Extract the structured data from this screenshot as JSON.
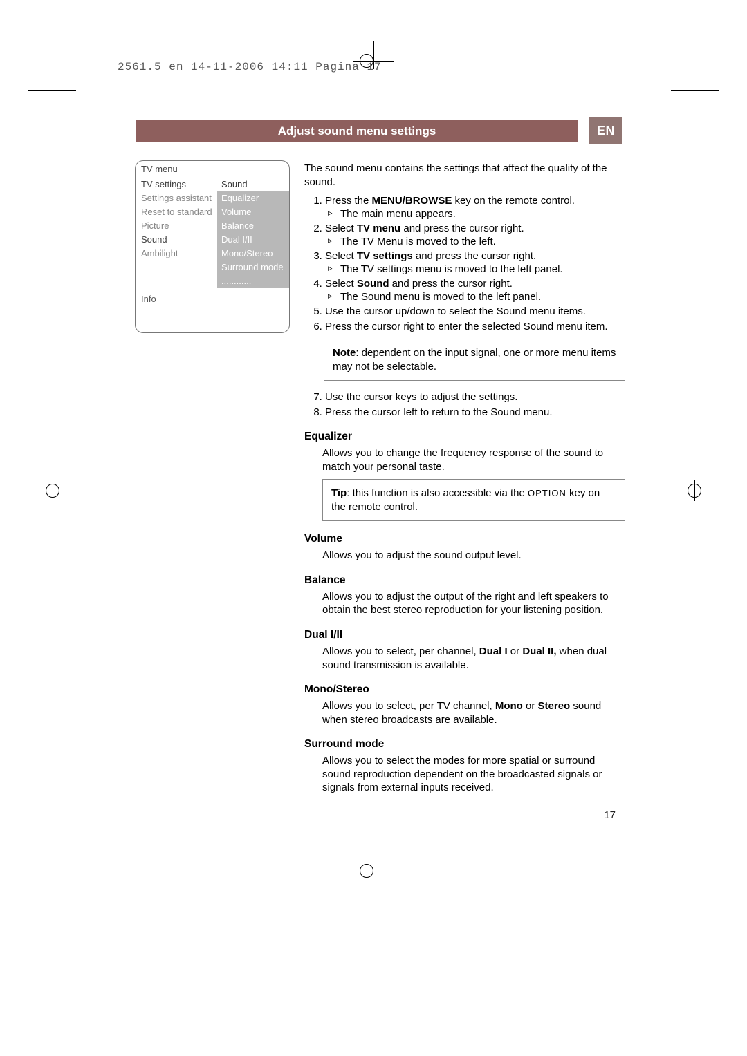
{
  "folio": "2561.5 en  14-11-2006  14:11  Pagina 17",
  "titlebar": "Adjust sound menu settings",
  "langtab": "EN",
  "menu": {
    "title": "TV menu",
    "left": [
      "TV settings",
      "Settings assistant",
      "Reset to standard",
      "Picture",
      "Sound",
      "Ambilight"
    ],
    "right_header": "Sound",
    "right": [
      "Equalizer",
      "Volume",
      "Balance",
      "Dual I/II",
      "Mono/Stereo",
      "Surround mode",
      "............"
    ],
    "info": "Info"
  },
  "intro": "The sound menu contains the settings that affect the quality of the sound.",
  "steps": [
    {
      "n": "1",
      "t": "Press the ",
      "b": "MENU/BROWSE",
      "t2": " key on the remote control.",
      "sub": "The main menu appears."
    },
    {
      "n": "2",
      "t": "Select ",
      "b": "TV menu",
      "t2": " and press the cursor right.",
      "sub": "The TV Menu is moved to the left."
    },
    {
      "n": "3",
      "t": "Select ",
      "b": "TV settings",
      "t2": " and press the cursor right.",
      "sub": "The TV settings menu is moved to the left panel."
    },
    {
      "n": "4",
      "t": "Select ",
      "b": "Sound",
      "t2": " and press the cursor right.",
      "sub": "The Sound menu is moved to the left panel."
    },
    {
      "n": "5",
      "t": "Use the cursor up/down to select the Sound menu items."
    },
    {
      "n": "6",
      "t": "Press the cursor right to enter the selected Sound menu item."
    }
  ],
  "note_b": "Note",
  "note": ": dependent on the input signal, one or more menu items may not be selectable.",
  "steps2": [
    {
      "n": "7",
      "t": "Use the cursor keys to adjust the settings."
    },
    {
      "n": "8",
      "t": "Press the cursor left to return to the Sound menu."
    }
  ],
  "sections": [
    {
      "h": "Equalizer",
      "p": "Allows you to change the frequency response of the sound to match your personal taste.",
      "tip_b": "Tip",
      "tip": ": this function is also accessible via the ",
      "tip_sc": "OPTION",
      "tip2": " key on the remote control."
    },
    {
      "h": "Volume",
      "p": "Allows you to adjust the sound output level."
    },
    {
      "h": "Balance",
      "p": "Allows you to adjust the output of the right and left speakers to obtain the best stereo reproduction for your listening position."
    },
    {
      "h": "Dual I/II",
      "p": "Allows you to select, per channel, ",
      "b1": "Dual I",
      "mid": " or ",
      "b2": "Dual II,",
      "p2": " when dual sound transmission is available."
    },
    {
      "h": "Mono/Stereo",
      "p": "Allows you to select, per TV channel, ",
      "b1": "Mono",
      "mid": " or ",
      "b2": "Stereo",
      "p2": " sound when stereo broadcasts are available."
    },
    {
      "h": "Surround mode",
      "p": "Allows you to select the modes for more spatial or surround sound reproduction dependent on the broadcasted signals or signals from external inputs received."
    }
  ],
  "pagenum": "17"
}
